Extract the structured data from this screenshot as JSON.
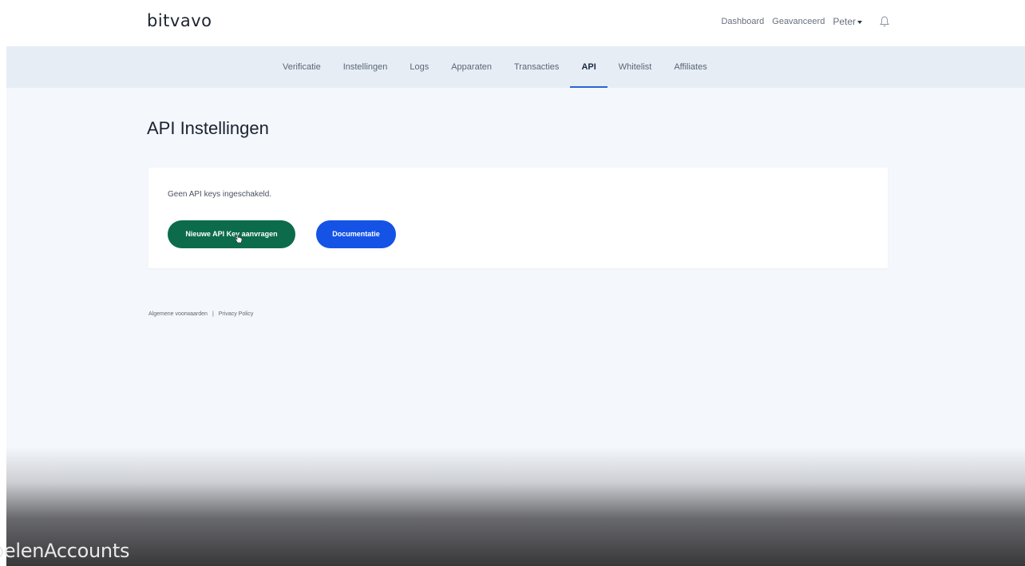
{
  "header": {
    "logo": "bitvavo",
    "nav": [
      "Dashboard",
      "Geavanceerd"
    ],
    "user": "Peter",
    "bell_icon": "bell-icon"
  },
  "subnav": {
    "items": [
      {
        "label": "Verificatie",
        "active": false
      },
      {
        "label": "Instellingen",
        "active": false
      },
      {
        "label": "Logs",
        "active": false
      },
      {
        "label": "Apparaten",
        "active": false
      },
      {
        "label": "Transacties",
        "active": false
      },
      {
        "label": "API",
        "active": true
      },
      {
        "label": "Whitelist",
        "active": false
      },
      {
        "label": "Affiliates",
        "active": false
      }
    ],
    "accent": "#2a64d6"
  },
  "main": {
    "title": "API Instellingen",
    "card": {
      "note": "Geen API keys ingeschakeld.",
      "new_key_button": "Nieuwe API Key aanvragen",
      "docs_button": "Documentatie"
    }
  },
  "footer": {
    "terms": "Algemene voorwaarden",
    "separator": "|",
    "privacy": "Privacy Policy"
  },
  "overlay": {
    "watermark": "belenAccounts"
  },
  "colors": {
    "primary_green": "#0c6b4b",
    "primary_blue": "#1453e6"
  }
}
